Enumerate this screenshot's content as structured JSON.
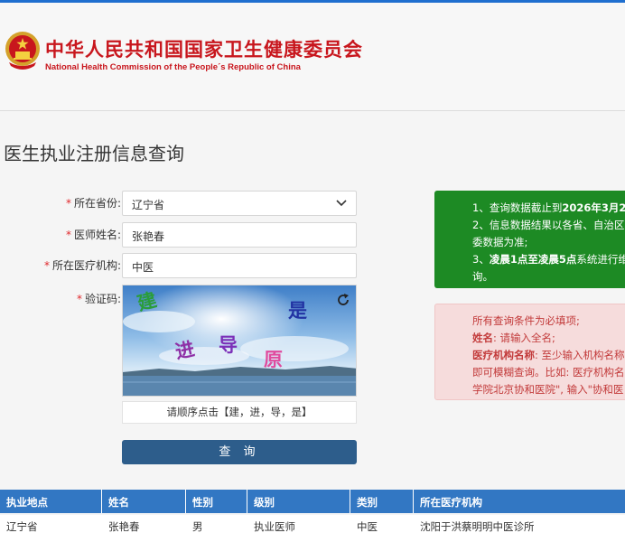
{
  "header": {
    "title_cn": "中华人民共和国国家卫生健康委员会",
    "title_en": "National Health Commission of the People´s Republic of China"
  },
  "page": {
    "title": "医生执业注册信息查询"
  },
  "form": {
    "required_mark": "*",
    "province": {
      "label": "所在省份:",
      "value": "辽宁省"
    },
    "doctor_name": {
      "label": "医师姓名:",
      "value": "张艳春"
    },
    "institution": {
      "label": "所在医疗机构:",
      "value": "中医"
    },
    "captcha": {
      "label": "验证码:",
      "chars": [
        "建",
        "是",
        "进",
        "导",
        "原"
      ],
      "colors": [
        "#2a9d3a",
        "#2233a3",
        "#8e2fa6",
        "#7b2fb8",
        "#e04b9e"
      ],
      "hint": "请顺序点击【建，进，导，是】"
    },
    "submit_label": "查 询"
  },
  "notice_green": {
    "line1_prefix": "1、查询数据截止到",
    "line1_bold": "2026年3月2",
    "line2": "2、信息数据结果以各省、自治区",
    "line3": "委数据为准;",
    "line4_prefix": "3、",
    "line4_bold": "凌晨1点至凌晨5点",
    "line4_suffix": "系统进行维",
    "line5": "询。"
  },
  "notice_red": {
    "line1": "所有查询条件为必填项;",
    "line2_bold": "姓名",
    "line2_rest": ": 请输入全名;",
    "line3_bold": "医疗机构名称",
    "line3_rest": ": 至少输入机构名称",
    "line4": "即可模糊查询。比如: 医疗机构名",
    "line5": "学院北京协和医院\", 输入\"协和医"
  },
  "table": {
    "headers": [
      "执业地点",
      "姓名",
      "性别",
      "级别",
      "类别",
      "所在医疗机构"
    ],
    "rows": [
      [
        "辽宁省",
        "张艳春",
        "男",
        "执业医师",
        "中医",
        "沈阳于洪蔡明明中医诊所"
      ]
    ]
  },
  "colors": {
    "brand_red": "#c8161d",
    "accent_blue": "#3277c3",
    "button_blue": "#2d5d8b",
    "notice_green": "#1d8a24",
    "notice_red_bg": "#f6dcdc"
  }
}
